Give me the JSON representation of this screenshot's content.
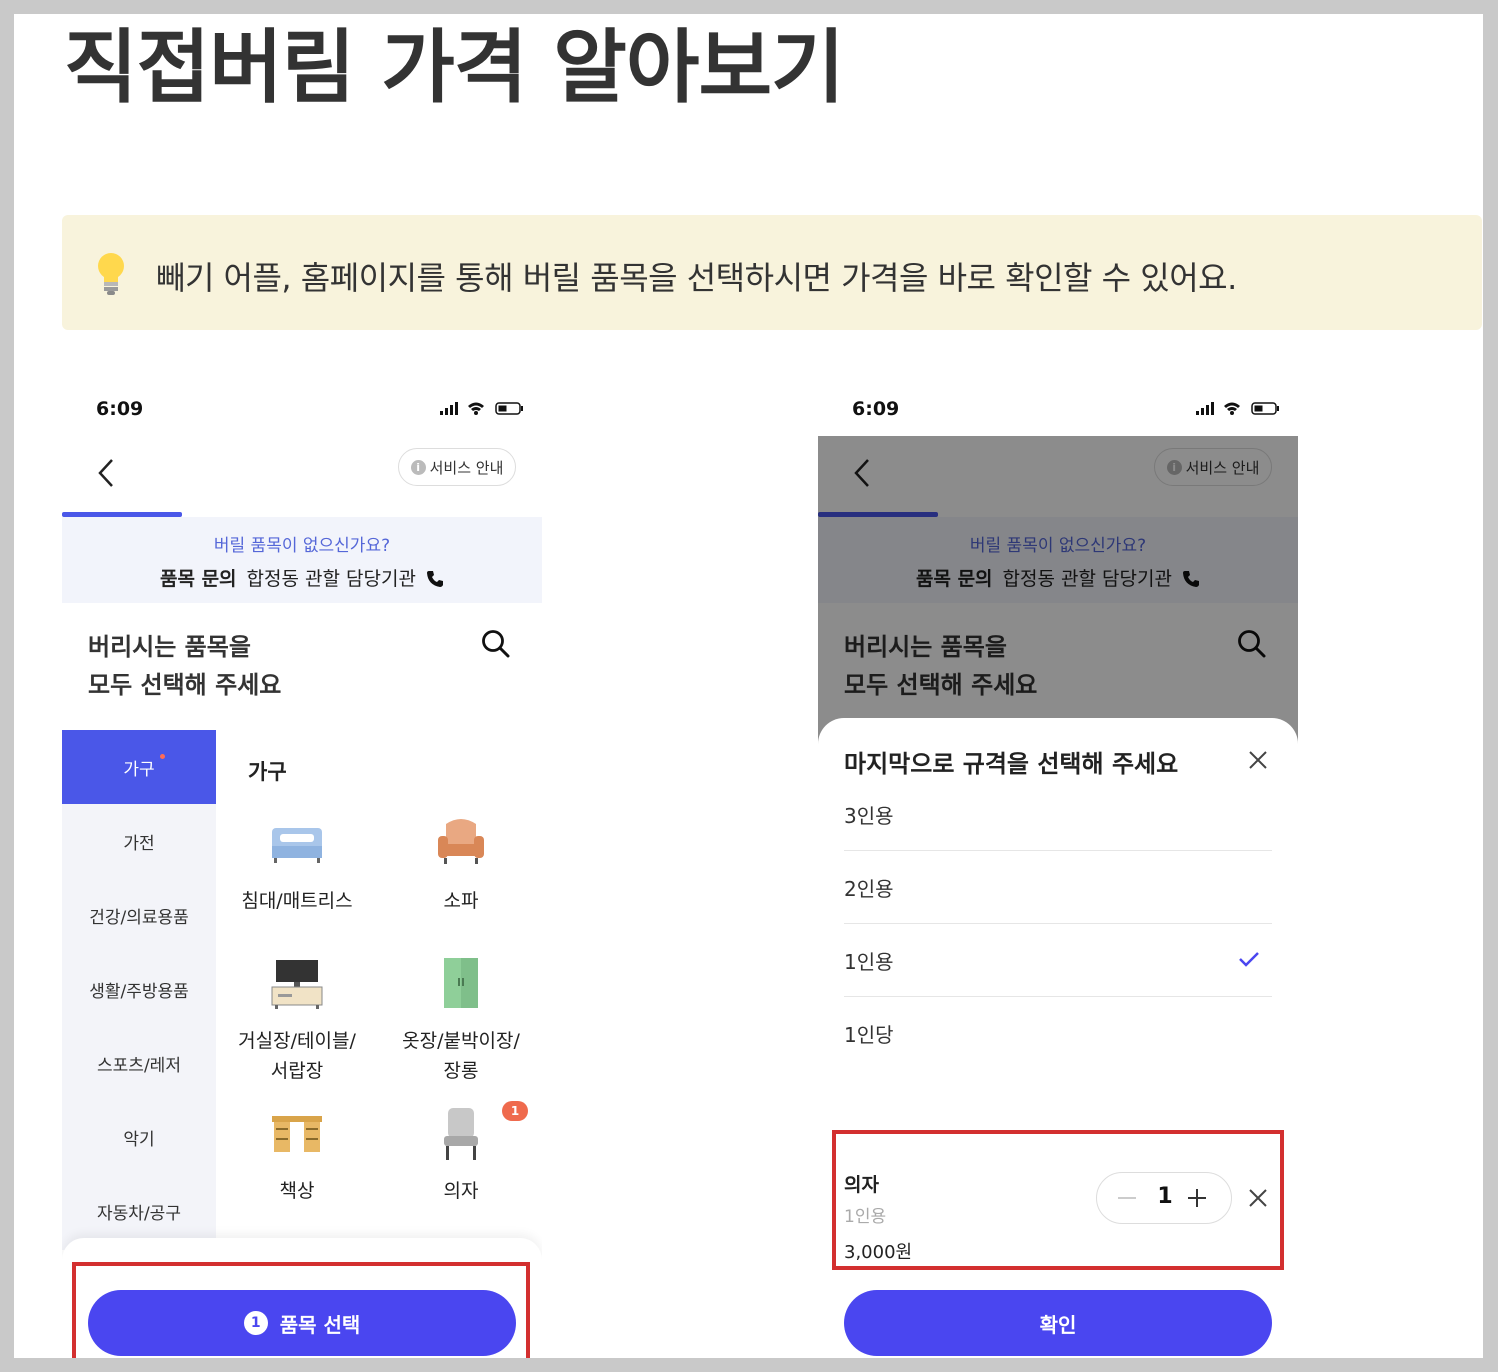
{
  "page": {
    "title": "직접버림 가격 알아보기",
    "tip": "빼기 어플, 홈페이지를 통해 버릴 품목을 선택하시면 가격을 바로 확인할 수 있어요."
  },
  "phone": {
    "time": "6:09",
    "service_label": "서비스 안내",
    "info_glyph": "i",
    "notice_question": "버릴 품목이 없으신가요?",
    "notice_label": "품목 문의",
    "notice_contact": "합정동 관할 담당기관",
    "headline_line1": "버리시는 품목을",
    "headline_line2": "모두 선택해 주세요"
  },
  "left": {
    "categories": [
      "가구",
      "가전",
      "건강/의료용품",
      "생활/주방용품",
      "스포츠/레저",
      "악기",
      "자동차/공구"
    ],
    "category_heading": "가구",
    "items": [
      {
        "label": "침대/매트리스",
        "icon": "bed-icon"
      },
      {
        "label": "소파",
        "icon": "sofa-icon"
      },
      {
        "label": "거실장/테이블/\n서랍장",
        "icon": "tv-stand-icon"
      },
      {
        "label": "옷장/붙박이장/\n장롱",
        "icon": "wardrobe-icon"
      },
      {
        "label": "책상",
        "icon": "desk-icon"
      },
      {
        "label": "의자",
        "icon": "chair-icon"
      }
    ],
    "chair_badge": "1",
    "cta_count": "1",
    "cta_label": "품목 선택"
  },
  "right": {
    "sheet_title": "마지막으로 규격을 선택해 주세요",
    "options": [
      "3인용",
      "2인용",
      "1인용",
      "1인당"
    ],
    "selected_option": "1인용",
    "selected_item_name": "의자",
    "selected_item_spec": "1인용",
    "selected_item_price": "3,000원",
    "quantity": "1",
    "confirm_label": "확인"
  },
  "colors": {
    "accent": "#4a46f0",
    "highlight_box": "#d32f2f",
    "tip_background": "#f8f3dc"
  }
}
